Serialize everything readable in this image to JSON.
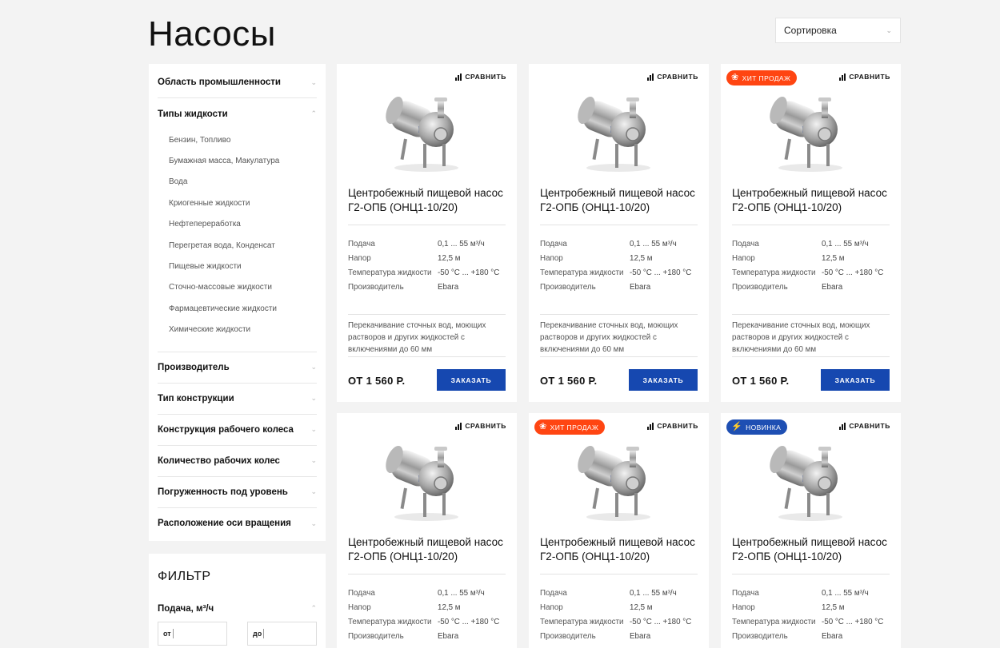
{
  "page": {
    "title": "Насосы"
  },
  "sort": {
    "label": "Сортировка"
  },
  "sidebar": {
    "categories": [
      {
        "label": "Область промышленности"
      },
      {
        "label": "Типы жидкости"
      },
      {
        "label": "Производитель"
      },
      {
        "label": "Тип конструкции"
      },
      {
        "label": "Конструкция рабочего колеса"
      },
      {
        "label": "Количество рабочих колес"
      },
      {
        "label": "Погруженность под уровень"
      },
      {
        "label": "Расположение оси вращения"
      }
    ],
    "fluid_types": [
      "Бензин, Топливо",
      "Бумажная масса, Макулатура",
      "Вода",
      "Криогенные жидкости",
      "Нефтепереработка",
      "Перегретая вода, Конденсат",
      "Пищевые жидкости",
      "Сточно-массовые жидкости",
      "Фармацевтические жидкости",
      "Химические жидкости"
    ]
  },
  "filter": {
    "title": "ФИЛЬТР",
    "flow_label": "Подача, м³/ч",
    "from_label": "от",
    "to_label": "до"
  },
  "colors": {
    "accent": "#1648b0",
    "hit": "#ff4512",
    "new": "#1e4fb3"
  },
  "icons": {
    "compare": "bar-chart-icon",
    "hit": "award-icon",
    "new": "lightning-icon",
    "chevron": "chevron-down-icon"
  },
  "products": [
    {
      "badge": null,
      "compare": "СРАВНИТЬ",
      "name": "Центробежный пищевой насос Г2-ОПБ (ОНЦ1-10/20)",
      "specs": [
        {
          "k": "Подача",
          "v": "0,1 ... 55 м³/ч"
        },
        {
          "k": "Напор",
          "v": "12,5 м"
        },
        {
          "k": "Температура жидкости",
          "v": "-50 °С ... +180 °С"
        },
        {
          "k": "Производитель",
          "v": "Ebara"
        }
      ],
      "desc": "Перекачивание сточных вод, моющих растворов и других жидкостей с включениями до 60 мм",
      "price": "ОТ 1 560 Р.",
      "order": "ЗАКАЗАТЬ"
    },
    {
      "badge": null,
      "compare": "СРАВНИТЬ",
      "name": "Центробежный пищевой насос Г2-ОПБ (ОНЦ1-10/20)",
      "specs": [
        {
          "k": "Подача",
          "v": "0,1 ... 55 м³/ч"
        },
        {
          "k": "Напор",
          "v": "12,5 м"
        },
        {
          "k": "Температура жидкости",
          "v": "-50 °С ... +180 °С"
        },
        {
          "k": "Производитель",
          "v": "Ebara"
        }
      ],
      "desc": "Перекачивание сточных вод, моющих растворов и других жидкостей с включениями до 60 мм",
      "price": "ОТ 1 560 Р.",
      "order": "ЗАКАЗАТЬ"
    },
    {
      "badge": {
        "type": "hit",
        "label": "ХИТ ПРОДАЖ"
      },
      "compare": "СРАВНИТЬ",
      "name": "Центробежный пищевой насос Г2-ОПБ (ОНЦ1-10/20)",
      "specs": [
        {
          "k": "Подача",
          "v": "0,1 ... 55 м³/ч"
        },
        {
          "k": "Напор",
          "v": "12,5 м"
        },
        {
          "k": "Температура жидкости",
          "v": "-50 °С ... +180 °С"
        },
        {
          "k": "Производитель",
          "v": "Ebara"
        }
      ],
      "desc": "Перекачивание сточных вод, моющих растворов и других жидкостей с включениями до 60 мм",
      "price": "ОТ 1 560 Р.",
      "order": "ЗАКАЗАТЬ"
    },
    {
      "badge": null,
      "compare": "СРАВНИТЬ",
      "name": "Центробежный пищевой насос Г2-ОПБ (ОНЦ1-10/20)",
      "specs": [
        {
          "k": "Подача",
          "v": "0,1 ... 55 м³/ч"
        },
        {
          "k": "Напор",
          "v": "12,5 м"
        },
        {
          "k": "Температура жидкости",
          "v": "-50 °С ... +180 °С"
        },
        {
          "k": "Производитель",
          "v": "Ebara"
        }
      ],
      "desc": "",
      "price": "",
      "order": ""
    },
    {
      "badge": {
        "type": "hit",
        "label": "ХИТ ПРОДАЖ"
      },
      "compare": "СРАВНИТЬ",
      "name": "Центробежный пищевой насос Г2-ОПБ (ОНЦ1-10/20)",
      "specs": [
        {
          "k": "Подача",
          "v": "0,1 ... 55 м³/ч"
        },
        {
          "k": "Напор",
          "v": "12,5 м"
        },
        {
          "k": "Температура жидкости",
          "v": "-50 °С ... +180 °С"
        },
        {
          "k": "Производитель",
          "v": "Ebara"
        }
      ],
      "desc": "",
      "price": "",
      "order": ""
    },
    {
      "badge": {
        "type": "new",
        "label": "НОВИНКА"
      },
      "compare": "СРАВНИТЬ",
      "name": "Центробежный пищевой насос Г2-ОПБ (ОНЦ1-10/20)",
      "specs": [
        {
          "k": "Подача",
          "v": "0,1 ... 55 м³/ч"
        },
        {
          "k": "Напор",
          "v": "12,5 м"
        },
        {
          "k": "Температура жидкости",
          "v": "-50 °С ... +180 °С"
        },
        {
          "k": "Производитель",
          "v": "Ebara"
        }
      ],
      "desc": "",
      "price": "",
      "order": ""
    }
  ]
}
